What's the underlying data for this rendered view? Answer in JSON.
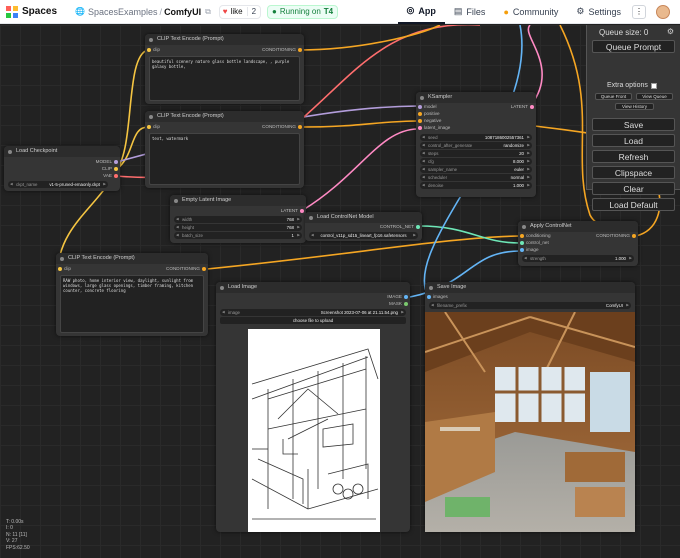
{
  "header": {
    "brand": "Spaces",
    "org": "SpacesExamples",
    "separator": "/",
    "repo": "ComfyUI",
    "like_label": "like",
    "like_count": "2",
    "status_label": "Running on",
    "hardware": "T4",
    "nav": [
      {
        "label": "App",
        "icon": "app-icon"
      },
      {
        "label": "Files",
        "icon": "files-icon"
      },
      {
        "label": "Community",
        "icon": "community-icon"
      },
      {
        "label": "Settings",
        "icon": "gear-icon"
      }
    ]
  },
  "nodes": {
    "clip_top": {
      "title": "CLIP Text Encode (Prompt)",
      "in": "clip",
      "out": "CONDITIONING",
      "text": "beautiful scenery nature glass bottle landscape, , purple galaxy bottle,"
    },
    "clip_neg": {
      "title": "CLIP Text Encode (Prompt)",
      "in": "clip",
      "out": "CONDITIONING",
      "text": "text, watermark"
    },
    "load_ckpt": {
      "title": "Load Checkpoint",
      "outs": [
        "MODEL",
        "CLIP",
        "VAE"
      ],
      "widget_label": "ckpt_name",
      "widget_value": "v1-5-pruned-emaonly.ckpt"
    },
    "empty_latent": {
      "title": "Empty Latent Image",
      "out": "LATENT",
      "widgets": [
        {
          "label": "width",
          "value": "768"
        },
        {
          "label": "height",
          "value": "768"
        },
        {
          "label": "batch_size",
          "value": "1"
        }
      ]
    },
    "controlnet_loader": {
      "title": "Load ControlNet Model",
      "out": "CONTROL_NET",
      "widget_value": "control_v11p_sd15_lineart_fp16.safetensors"
    },
    "ksampler": {
      "title": "KSampler",
      "ins": [
        "model",
        "positive",
        "negative",
        "latent_image"
      ],
      "out": "LATENT",
      "widgets": [
        {
          "label": "seed",
          "value": "1087186002557361"
        },
        {
          "label": "control_after_generate",
          "value": "randomize"
        },
        {
          "label": "steps",
          "value": "20"
        },
        {
          "label": "cfg",
          "value": "8.000"
        },
        {
          "label": "sampler_name",
          "value": "euler"
        },
        {
          "label": "scheduler",
          "value": "normal"
        },
        {
          "label": "denoise",
          "value": "1.000"
        }
      ]
    },
    "apply_cn": {
      "title": "Apply ControlNet",
      "ins": [
        "conditioning",
        "control_net",
        "image"
      ],
      "out": "CONDITIONING",
      "widget_label": "strength",
      "widget_value": "1.000"
    },
    "clip_pos": {
      "title": "CLIP Text Encode (Prompt)",
      "in": "clip",
      "out": "CONDITIONING",
      "text": "RAW photo, home interior view, daylight, sunlight from windows, large glass openings, timber framing, kitchen counter, concrete flooring"
    },
    "load_image": {
      "title": "Load Image",
      "outs": [
        "IMAGE",
        "MASK"
      ],
      "widget_label": "image",
      "widget_value": "Screenshot 2023-07-06 at 21.11.54.png",
      "upload_label": "choose file to upload"
    },
    "save_image": {
      "title": "Save Image",
      "in": "images",
      "widget_label": "filename_prefix",
      "widget_value": "ComfyUI"
    }
  },
  "menu": {
    "queue_size": "Queue size: 0",
    "queue_prompt": "Queue Prompt",
    "extra_options": "Extra options",
    "small_buttons": [
      "Queue Front",
      "View Queue",
      "View History"
    ],
    "buttons": [
      "Save",
      "Load",
      "Refresh",
      "Clipspace",
      "Clear",
      "Load Default"
    ]
  },
  "stats": [
    "T: 0.00s",
    "I: 0",
    "N: 11 [11]",
    "V: 27",
    "FPS:62.50"
  ],
  "colors": {
    "clip": "#f5c542",
    "conditioning": "#f5a623",
    "model": "#b39ddb",
    "latent": "#ff8ac4",
    "vae": "#ff6e6e",
    "control_net": "#6ee7b7",
    "image": "#64b5f6"
  }
}
